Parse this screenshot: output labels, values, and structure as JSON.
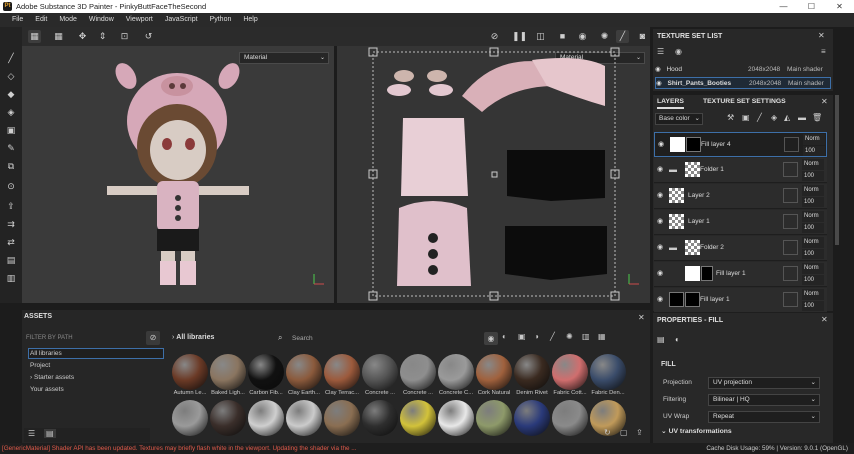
{
  "window": {
    "app_icon_text": "Pt",
    "title": "Adobe Substance 3D Painter - PinkyButtFaceTheSecond"
  },
  "menu": [
    "File",
    "Edit",
    "Mode",
    "Window",
    "Viewport",
    "JavaScript",
    "Python",
    "Help"
  ],
  "viewport3d": {
    "channel": "Material"
  },
  "viewport2d": {
    "channel": "Material"
  },
  "texture_set_list": {
    "title": "TEXTURE SET LIST",
    "rows": [
      {
        "name": "Hood",
        "resolution": "2048x2048",
        "shader": "Main shader",
        "selected": false
      },
      {
        "name": "Shirt_Pants_Booties",
        "resolution": "2048x2048",
        "shader": "Main shader",
        "selected": true
      }
    ]
  },
  "layers_panel": {
    "tabs": [
      "LAYERS",
      "TEXTURE SET SETTINGS"
    ],
    "channel": "Base color",
    "layers": [
      {
        "name": "Fill layer 4",
        "blend": "Norm",
        "opacity": "100",
        "selected": true
      },
      {
        "name": "Folder 1",
        "blend": "Norm",
        "opacity": "100",
        "selected": false
      },
      {
        "name": "Layer 2",
        "blend": "Norm",
        "opacity": "100",
        "selected": false
      },
      {
        "name": "Layer 1",
        "blend": "Norm",
        "opacity": "100",
        "selected": false
      },
      {
        "name": "Folder 2",
        "blend": "Norm",
        "opacity": "100",
        "selected": false
      },
      {
        "name": "Fill layer 1",
        "blend": "Norm",
        "opacity": "100",
        "selected": false
      },
      {
        "name": "Fill layer 1",
        "blend": "Norm",
        "opacity": "100",
        "selected": false
      }
    ]
  },
  "properties": {
    "title": "PROPERTIES - FILL",
    "section": "FILL",
    "projection_label": "Projection",
    "projection_value": "UV projection",
    "filtering_label": "Filtering",
    "filtering_value": "Bilinear | HQ",
    "uvwrap_label": "UV Wrap",
    "uvwrap_value": "Repeat",
    "uv_transformations": "UV transformations"
  },
  "assets": {
    "title": "ASSETS",
    "filter_placeholder": "FILTER BY PATH",
    "library_title": "All libraries",
    "search_placeholder": "Search",
    "categories": [
      "All libraries",
      "Project",
      "Starter assets",
      "Your assets"
    ],
    "materials": [
      {
        "label": "Autumn Le...",
        "color": "#6b3a26"
      },
      {
        "label": "Baked Ligh...",
        "color": "#8a7560"
      },
      {
        "label": "Carbon Fib...",
        "color": "#111111"
      },
      {
        "label": "Clay Earth...",
        "color": "#8b5a3c"
      },
      {
        "label": "Clay Terrac...",
        "color": "#9c5a3c"
      },
      {
        "label": "Concrete ...",
        "color": "#555555"
      },
      {
        "label": "Concrete ...",
        "color": "#8e8e8e"
      },
      {
        "label": "Concrete C...",
        "color": "#9a9a9a"
      },
      {
        "label": "Cork Natural",
        "color": "#a0613d"
      },
      {
        "label": "Denim Rivet",
        "color": "#3a2a20"
      },
      {
        "label": "Fabric Cott...",
        "color": "#d06e6e"
      },
      {
        "label": "Fabric Den...",
        "color": "#3a4c6a"
      }
    ],
    "materials_row2": [
      "#9a9a9a",
      "#3a2e2a",
      "#cfcfcf",
      "#cbcbcb",
      "#8a6e52",
      "#2e2e2e",
      "#d2c23a",
      "#e8e8e8",
      "#8e9a6a",
      "#2a3a7a",
      "#8a8a8a",
      "#c09a5a"
    ]
  },
  "status": {
    "message": "[GenericMaterial] Shader API has been updated. Textures may briefly flash white in the viewport. Updating the shader via the ...",
    "right": "Cache Disk Usage:  59%  |  Version: 9.0.1 (OpenGL)"
  }
}
